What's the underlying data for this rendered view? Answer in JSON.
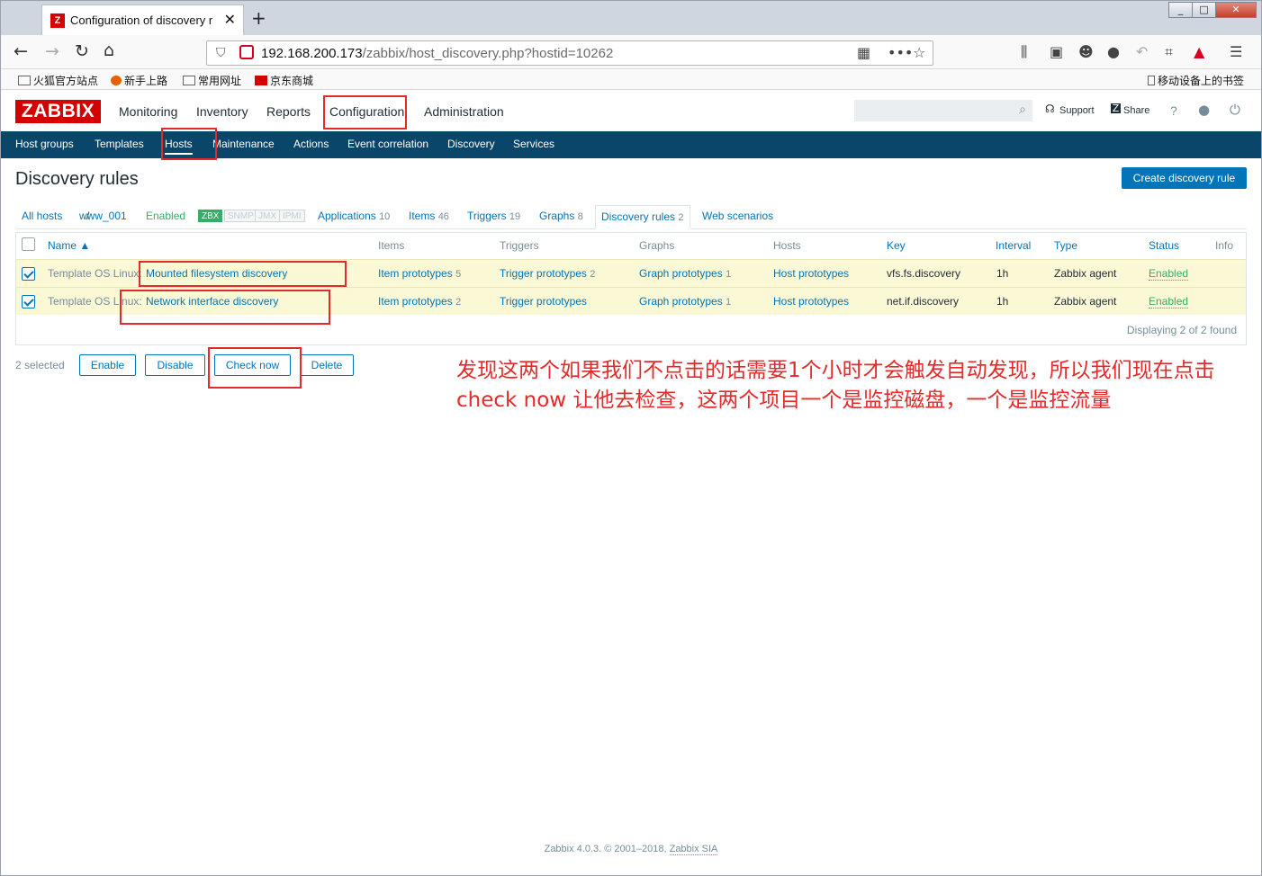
{
  "browser": {
    "tab_favicon": "Z",
    "tab_title": "Configuration of discovery r",
    "url_host": "192.168.200.173",
    "url_path": "/zabbix/host_discovery.php?hostid=10262",
    "bookmarks": [
      "火狐官方站点",
      "新手上路",
      "常用网址",
      "京东商城"
    ],
    "mobile_bookmarks": "移动设备上的书签"
  },
  "zabbix": {
    "logo": "ZABBIX",
    "top_menu": [
      "Monitoring",
      "Inventory",
      "Reports",
      "Configuration",
      "Administration"
    ],
    "header_links": {
      "support": "Support",
      "share": "Share",
      "help": "?"
    },
    "sub_menu": [
      "Host groups",
      "Templates",
      "Hosts",
      "Maintenance",
      "Actions",
      "Event correlation",
      "Discovery",
      "Services"
    ]
  },
  "page": {
    "title": "Discovery rules",
    "create_button": "Create discovery rule",
    "breadcrumb": {
      "all_hosts": "All hosts",
      "sep": "/",
      "host": "www_001",
      "status": "Enabled"
    },
    "availability": [
      "ZBX",
      "SNMP",
      "JMX",
      "IPMI"
    ],
    "host_tabs": [
      {
        "label": "Applications",
        "count": "10"
      },
      {
        "label": "Items",
        "count": "46"
      },
      {
        "label": "Triggers",
        "count": "19"
      },
      {
        "label": "Graphs",
        "count": "8"
      },
      {
        "label": "Discovery rules",
        "count": "2"
      },
      {
        "label": "Web scenarios",
        "count": ""
      }
    ]
  },
  "table": {
    "headers": [
      "Name ▲",
      "Items",
      "Triggers",
      "Graphs",
      "Hosts",
      "Key",
      "Interval",
      "Type",
      "Status",
      "Info"
    ],
    "rows": [
      {
        "template": "Template OS Linux",
        "name": "Mounted filesystem discovery",
        "items": "Item prototypes",
        "items_count": "5",
        "triggers": "Trigger prototypes",
        "triggers_count": "2",
        "graphs": "Graph prototypes",
        "graphs_count": "1",
        "hosts": "Host prototypes",
        "key": "vfs.fs.discovery",
        "interval": "1h",
        "type": "Zabbix agent",
        "status": "Enabled"
      },
      {
        "template": "Template OS Linux",
        "name": "Network interface discovery",
        "items": "Item prototypes",
        "items_count": "2",
        "triggers": "Trigger prototypes",
        "triggers_count": "",
        "graphs": "Graph prototypes",
        "graphs_count": "1",
        "hosts": "Host prototypes",
        "key": "net.if.discovery",
        "interval": "1h",
        "type": "Zabbix agent",
        "status": "Enabled"
      }
    ],
    "footer": "Displaying 2 of 2 found"
  },
  "actions": {
    "selected": "2 selected",
    "buttons": [
      "Enable",
      "Disable",
      "Check now",
      "Delete"
    ]
  },
  "annotation": {
    "line1": "发现这两个如果我们不点击的话需要1个小时才会触发自动发现，所以我们现在点击",
    "line2": "check now 让他去检查，这两个项目一个是监控磁盘，一个是监控流量"
  },
  "footer": {
    "text": "Zabbix 4.0.3. © 2001–2018,",
    "link": "Zabbix SIA"
  }
}
